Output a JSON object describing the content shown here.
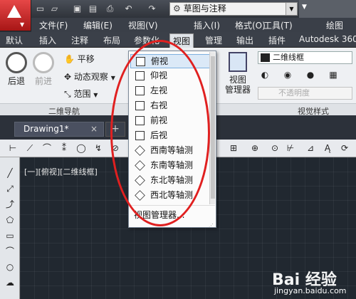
{
  "titlebar": {
    "workspace": "草图与注释"
  },
  "menubar": [
    "文件(F)",
    "编辑(E)",
    "视图(V)",
    "插入(I)",
    "格式(O)",
    "工具(T)",
    "绘图"
  ],
  "tabs": [
    {
      "label": "默认"
    },
    {
      "label": "插入"
    },
    {
      "label": "注释"
    },
    {
      "label": "布局"
    },
    {
      "label": "参数化"
    },
    {
      "label": "视图",
      "active": true
    },
    {
      "label": "管理"
    },
    {
      "label": "输出"
    },
    {
      "label": "插件"
    },
    {
      "label": "Autodesk 360"
    }
  ],
  "ribbon": {
    "back": "后退",
    "forward": "前进",
    "pan": "平移",
    "orbit": "动态观察",
    "extent": "范围",
    "panel_nav": "二维导航",
    "view_manager": "视图\n管理器",
    "visual_style": "二维线框",
    "transparency": "不透明度",
    "panel_visual": "视觉样式"
  },
  "doc": {
    "tab": "Drawing1*",
    "close": "×",
    "new": "+"
  },
  "viewport_label": "[一][俯视][二维线框]",
  "dropdown": {
    "items": [
      {
        "label": "俯视",
        "selected": true
      },
      {
        "label": "仰视"
      },
      {
        "label": "左视"
      },
      {
        "label": "右视"
      },
      {
        "label": "前视"
      },
      {
        "label": "后视"
      },
      {
        "label": "西南等轴测"
      },
      {
        "label": "东南等轴测"
      },
      {
        "label": "东北等轴测"
      },
      {
        "label": "西北等轴测"
      }
    ],
    "footer": "视图管理器..."
  },
  "watermark": {
    "brand": "Bai 经验",
    "url": "jingyan.baidu.com"
  },
  "colors": {
    "highlight_ellipse": "#e02020",
    "accent_red": "#c62020",
    "selected_item": "#dbe9f7"
  }
}
